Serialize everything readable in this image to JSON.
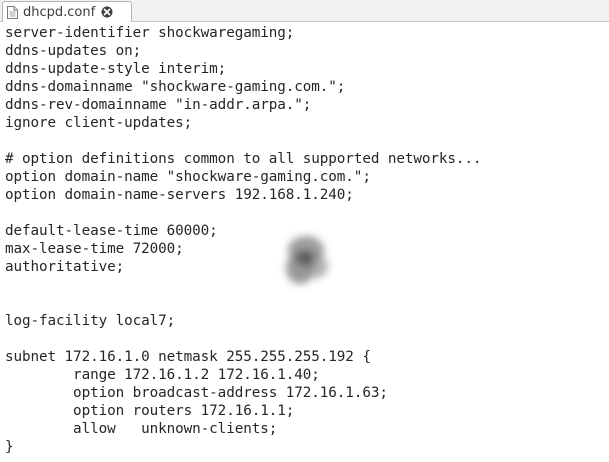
{
  "tab": {
    "title": "dhcpd.conf",
    "icon": "document-icon",
    "close_icon": "close-icon"
  },
  "editor": {
    "lines": [
      "server-identifier shockwaregaming;",
      "ddns-updates on;",
      "ddns-update-style interim;",
      "ddns-domainname \"shockware-gaming.com.\";",
      "ddns-rev-domainname \"in-addr.arpa.\";",
      "ignore client-updates;",
      "",
      "# option definitions common to all supported networks...",
      "option domain-name \"shockware-gaming.com.\";",
      "option domain-name-servers 192.168.1.240;",
      "",
      "default-lease-time 60000;",
      "max-lease-time 72000;",
      "authoritative;",
      "",
      "",
      "log-facility local7;",
      "",
      "subnet 172.16.1.0 netmask 255.255.255.192 {",
      "        range 172.16.1.2 172.16.1.40;",
      "        option broadcast-address 172.16.1.63;",
      "        option routers 172.16.1.1;",
      "        allow   unknown-clients;",
      "}"
    ]
  },
  "colors": {
    "text": "#262626",
    "tabbar_bg": "#f2f1f0",
    "tab_bg": "#ffffff",
    "editor_bg": "#ffffff"
  }
}
